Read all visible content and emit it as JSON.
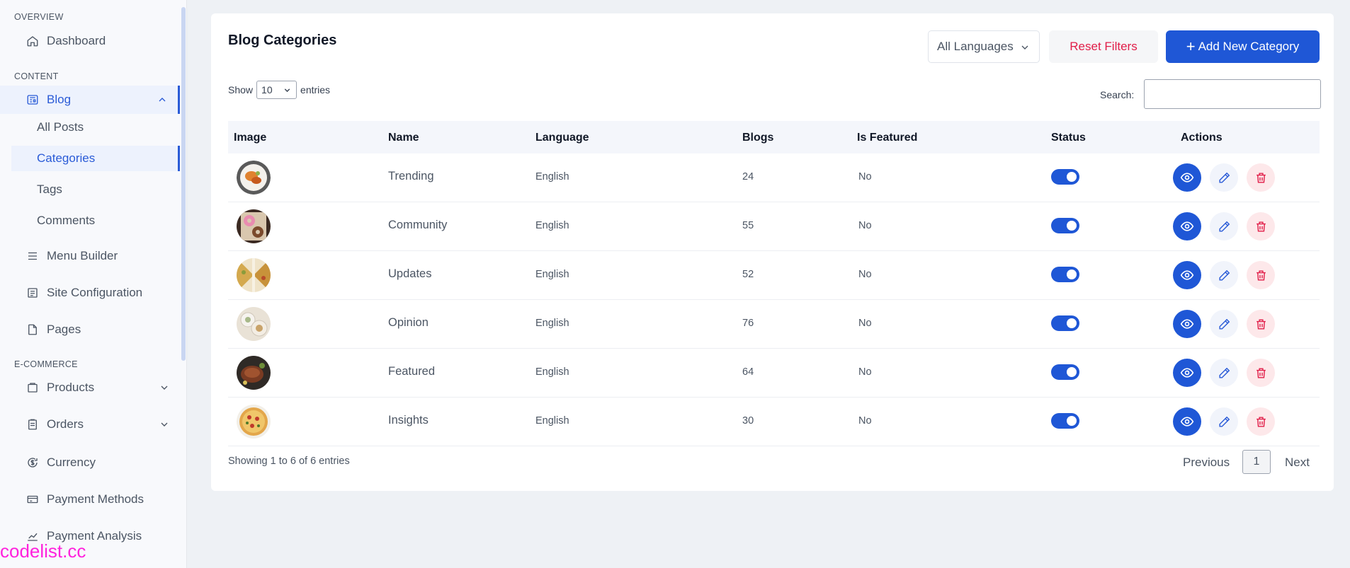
{
  "sidebar": {
    "sections": {
      "overview": "OVERVIEW",
      "content": "CONTENT",
      "ecommerce": "E-COMMERCE"
    },
    "items": {
      "dashboard": "Dashboard",
      "blog": "Blog",
      "menu_builder": "Menu Builder",
      "site_configuration": "Site Configuration",
      "pages": "Pages",
      "products": "Products",
      "orders": "Orders",
      "currency": "Currency",
      "payment_methods": "Payment Methods",
      "payment_analysis": "Payment Analysis"
    },
    "blog_sub": {
      "all_posts": "All Posts",
      "categories": "Categories",
      "tags": "Tags",
      "comments": "Comments"
    }
  },
  "watermark": "codelist.cc",
  "header": {
    "title": "Blog Categories",
    "language_filter": "All Languages",
    "reset_label": "Reset Filters",
    "add_label": "Add New Category"
  },
  "table_controls": {
    "show_label": "Show",
    "entries_value": "10",
    "entries_label": "entries",
    "search_label": "Search:"
  },
  "table": {
    "columns": [
      "Image",
      "Name",
      "Language",
      "Blogs",
      "Is Featured",
      "Status",
      "Actions"
    ],
    "rows": [
      {
        "name": "Trending",
        "language": "English",
        "blogs": "24",
        "featured": "No",
        "status_on": true
      },
      {
        "name": "Community",
        "language": "English",
        "blogs": "55",
        "featured": "No",
        "status_on": true
      },
      {
        "name": "Updates",
        "language": "English",
        "blogs": "52",
        "featured": "No",
        "status_on": true
      },
      {
        "name": "Opinion",
        "language": "English",
        "blogs": "76",
        "featured": "No",
        "status_on": true
      },
      {
        "name": "Featured",
        "language": "English",
        "blogs": "64",
        "featured": "No",
        "status_on": true
      },
      {
        "name": "Insights",
        "language": "English",
        "blogs": "30",
        "featured": "No",
        "status_on": true
      }
    ]
  },
  "footer": {
    "info": "Showing 1 to 6 of 6 entries",
    "prev_label": "Previous",
    "current_page": "1",
    "next_label": "Next"
  },
  "colors": {
    "accent": "#1f57d6",
    "danger": "#e11d48",
    "toggle_on": "#1f57d6"
  }
}
